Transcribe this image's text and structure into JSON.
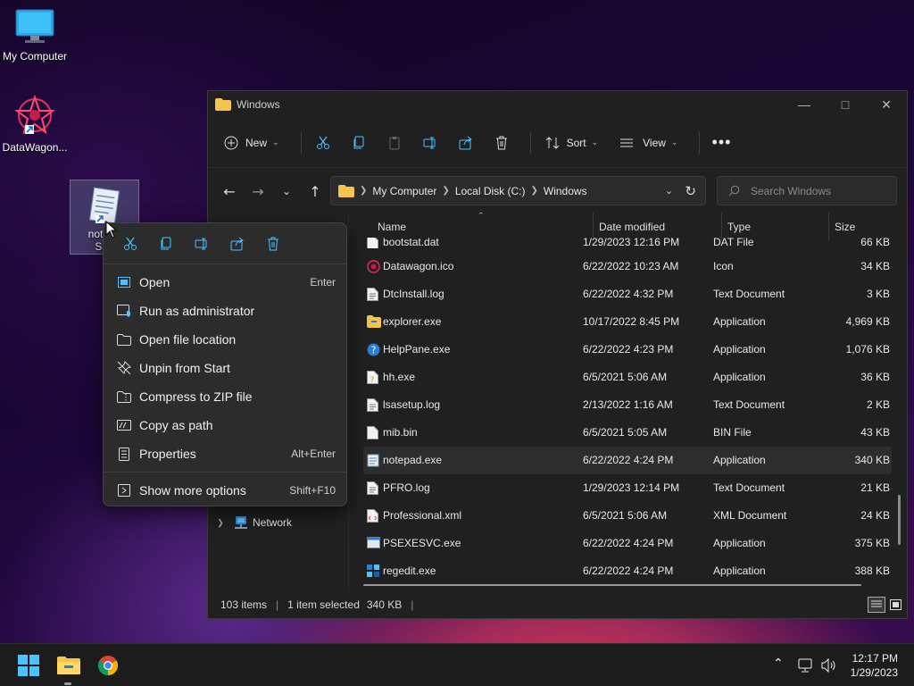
{
  "desktop": {
    "icons": [
      {
        "label": "My Computer",
        "icon": "monitor-icon"
      },
      {
        "label": "DataWagon...",
        "icon": "datawagon-logo-icon"
      },
      {
        "label_line1": "notepa",
        "label_line2": "Sho",
        "icon": "notepad-icon"
      }
    ]
  },
  "window": {
    "title": "Windows",
    "toolbar": {
      "new_label": "New",
      "sort_label": "Sort",
      "view_label": "View"
    },
    "breadcrumb": [
      "My Computer",
      "Local Disk (C:)",
      "Windows"
    ],
    "search_placeholder": "Search Windows",
    "columns": {
      "name": "Name",
      "date": "Date modified",
      "type": "Type",
      "size": "Size"
    },
    "sidebar": {
      "network_label": "Network"
    },
    "files": [
      {
        "name": "bootstat.dat",
        "date": "1/29/2023 12:16 PM",
        "type": "DAT File",
        "size": "66 KB",
        "icon": "file-icon"
      },
      {
        "name": "Datawagon.ico",
        "date": "6/22/2022 10:23 AM",
        "type": "Icon",
        "size": "34 KB",
        "icon": "datawagon-icon"
      },
      {
        "name": "DtcInstall.log",
        "date": "6/22/2022 4:32 PM",
        "type": "Text Document",
        "size": "3 KB",
        "icon": "text-file-icon"
      },
      {
        "name": "explorer.exe",
        "date": "10/17/2022 8:45 PM",
        "type": "Application",
        "size": "4,969 KB",
        "icon": "folder-app-icon"
      },
      {
        "name": "HelpPane.exe",
        "date": "6/22/2022 4:23 PM",
        "type": "Application",
        "size": "1,076 KB",
        "icon": "help-icon"
      },
      {
        "name": "hh.exe",
        "date": "6/5/2021 5:06 AM",
        "type": "Application",
        "size": "36 KB",
        "icon": "help-file-icon"
      },
      {
        "name": "lsasetup.log",
        "date": "2/13/2022 1:16 AM",
        "type": "Text Document",
        "size": "2 KB",
        "icon": "text-file-icon"
      },
      {
        "name": "mib.bin",
        "date": "6/5/2021 5:05 AM",
        "type": "BIN File",
        "size": "43 KB",
        "icon": "file-icon"
      },
      {
        "name": "notepad.exe",
        "date": "6/22/2022 4:24 PM",
        "type": "Application",
        "size": "340 KB",
        "icon": "notepad-file-icon",
        "selected": true
      },
      {
        "name": "PFRO.log",
        "date": "1/29/2023 12:14 PM",
        "type": "Text Document",
        "size": "21 KB",
        "icon": "text-file-icon"
      },
      {
        "name": "Professional.xml",
        "date": "6/5/2021 5:06 AM",
        "type": "XML Document",
        "size": "24 KB",
        "icon": "xml-file-icon"
      },
      {
        "name": "PSEXESVC.exe",
        "date": "6/22/2022 4:24 PM",
        "type": "Application",
        "size": "375 KB",
        "icon": "app-window-icon"
      },
      {
        "name": "regedit.exe",
        "date": "6/22/2022 4:24 PM",
        "type": "Application",
        "size": "388 KB",
        "icon": "regedit-icon"
      }
    ],
    "status": {
      "items": "103 items",
      "selected": "1 item selected",
      "size": "340 KB"
    }
  },
  "context_menu": {
    "items": [
      {
        "label": "Open",
        "shortcut": "Enter"
      },
      {
        "label": "Run as administrator",
        "shortcut": ""
      },
      {
        "label": "Open file location",
        "shortcut": ""
      },
      {
        "label": "Unpin from Start",
        "shortcut": ""
      },
      {
        "label": "Compress to ZIP file",
        "shortcut": ""
      },
      {
        "label": "Copy as path",
        "shortcut": ""
      },
      {
        "label": "Properties",
        "shortcut": "Alt+Enter"
      },
      {
        "label": "Show more options",
        "shortcut": "Shift+F10"
      }
    ]
  },
  "taskbar": {
    "time": "12:17 PM",
    "date": "1/29/2023"
  },
  "colors": {
    "accent": "#4cc2ff",
    "folder": "#f4c44e",
    "window_bg": "#202020",
    "menu_bg": "#2c2c2c"
  }
}
